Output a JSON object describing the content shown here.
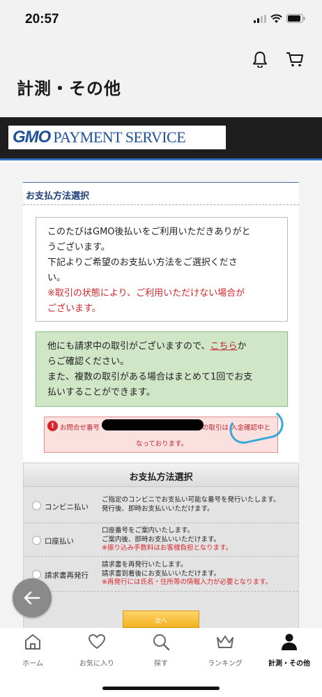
{
  "status_bar": {
    "time": "20:57"
  },
  "header": {
    "title": "計測・その他",
    "icons": [
      "bell-icon",
      "cart-icon"
    ]
  },
  "gmo": {
    "logo_mark": "GMO",
    "logo_text": "PAYMENT SERVICE"
  },
  "section": {
    "heading": "お支払方法選択"
  },
  "intro": {
    "lines": [
      "このたびはGMO後払いをご利用いただきありがと",
      "うございます。",
      "下記よりご希望のお支払い方法をご選択くださ",
      "い。"
    ],
    "warning_lines": [
      "※取引の状態により、ご利用いただけない場合が",
      "ございます。"
    ]
  },
  "notice": {
    "line1_pre": "他にも請求中の取引がございますので、",
    "link": "こちら",
    "line1_post": "か",
    "line2": "らご確認ください。",
    "line3": "また、複数の取引がある場合はまとめて1回でお支",
    "line4": "払いすることができます。"
  },
  "alert": {
    "icon": "!",
    "text_pre": "お問合せ番号",
    "text_post": "の取引は 入金確認中と",
    "text_line2": "なっております。"
  },
  "payment": {
    "title": "お支払方法選択",
    "methods": [
      {
        "label": "コンビニ払い",
        "desc": [
          "ご指定のコンビニでお支払い可能な番号を発行いたします。",
          "発行後、即時お支払いいただけます。"
        ],
        "warning": ""
      },
      {
        "label": "口座払い",
        "desc": [
          "口座番号をご案内いたします。",
          "ご案内後、即時お支払いいただけます。"
        ],
        "warning": "※振り込み手数料はお客様負担となります。"
      },
      {
        "label": "請求書再発行",
        "desc": [
          "請求書を再発行いたします。",
          "請求書到着後にお支払いいただけます。"
        ],
        "warning": "※再発行には氏名・住所等の情報入力が必要となります。"
      }
    ],
    "next_label": "次へ"
  },
  "tabs": [
    {
      "label": "ホーム",
      "icon": "home-icon",
      "active": false
    },
    {
      "label": "お気に入り",
      "icon": "heart-icon",
      "active": false
    },
    {
      "label": "探す",
      "icon": "search-icon",
      "active": false
    },
    {
      "label": "ランキング",
      "icon": "crown-icon",
      "active": false
    },
    {
      "label": "計測・その他",
      "icon": "person-icon",
      "active": true
    }
  ],
  "colors": {
    "accent_red": "#d8262b",
    "gmo_blue": "#1e4f9a",
    "notice_green": "#cfe6c7",
    "button_orange": "#f3b21f"
  }
}
